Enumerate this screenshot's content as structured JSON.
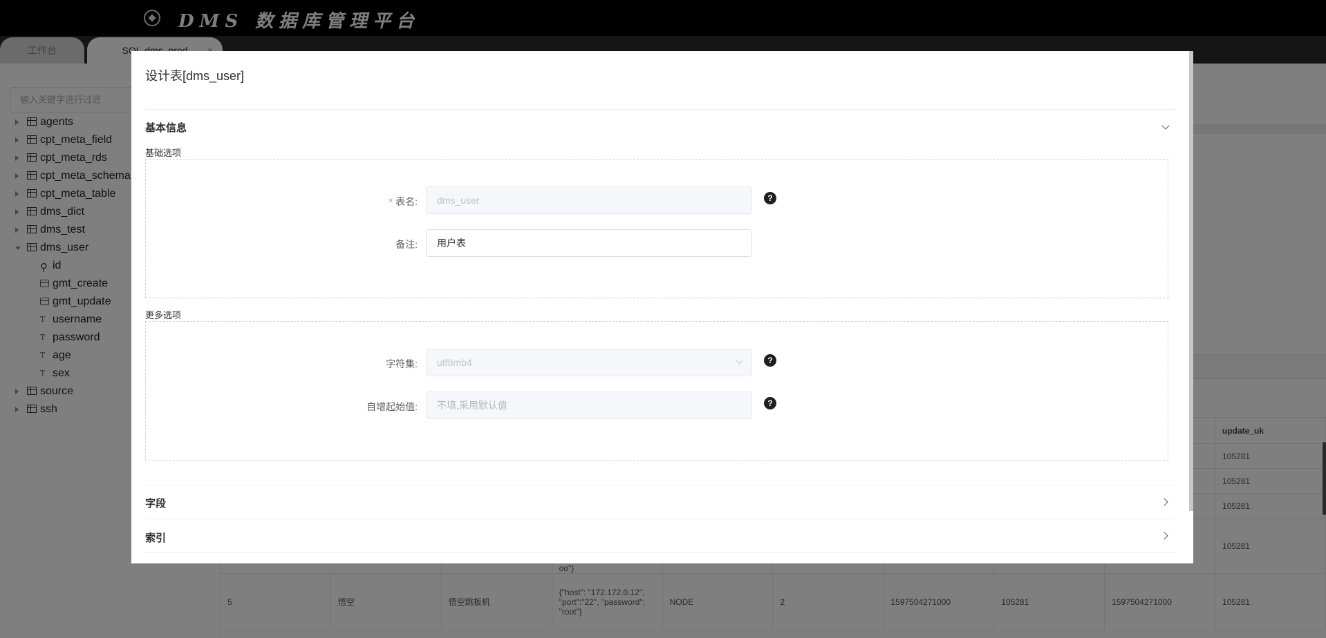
{
  "header": {
    "brand": "DMS 数据库管理平台"
  },
  "tabs": [
    {
      "label": "工作台"
    },
    {
      "label": "SQL-dms_prod",
      "close": "×"
    }
  ],
  "sidebar": {
    "filter_placeholder": "输入关键字进行过滤",
    "tables": [
      {
        "name": "agents"
      },
      {
        "name": "cpt_meta_field"
      },
      {
        "name": "cpt_meta_rds"
      },
      {
        "name": "cpt_meta_schema"
      },
      {
        "name": "cpt_meta_table"
      },
      {
        "name": "dms_dict"
      },
      {
        "name": "dms_test"
      },
      {
        "name": "dms_user",
        "expanded": true
      },
      {
        "name": "source"
      },
      {
        "name": "ssh"
      }
    ],
    "columns": [
      {
        "name": "id",
        "icon": "key-icon"
      },
      {
        "name": "gmt_create",
        "icon": "datetime-icon"
      },
      {
        "name": "gmt_update",
        "icon": "datetime-icon"
      },
      {
        "name": "username",
        "icon": "text-type-icon"
      },
      {
        "name": "password",
        "icon": "text-type-icon"
      },
      {
        "name": "age",
        "icon": "text-type-icon"
      },
      {
        "name": "sex",
        "icon": "text-type-icon"
      }
    ]
  },
  "result_grid": {
    "last_header": "update_uk",
    "rows": [
      {
        "c9": "105281"
      },
      {
        "c9": "105281"
      },
      {
        "c9": "105281"
      },
      {
        "c3_tail": "oo\"}",
        "c9": "105281"
      },
      {
        "c0": "5",
        "c1": "悟空",
        "c2": "悟空跳板机",
        "c3": "{\"host\": \"172.172.0.12\", \"port\":\"22\", \"password\": \"root\"}",
        "c4": "NODE",
        "c5": "2",
        "c6": "1597504271000",
        "c7": "105281",
        "c8": "1597504271000",
        "c9": "105281"
      }
    ]
  },
  "modal": {
    "title": "设计表[dms_user]",
    "basic_section": "基本信息",
    "basic_options": "基础选项",
    "table_name_label": "表名:",
    "table_name_value": "dms_user",
    "remark_label": "备注:",
    "remark_value": "用户表",
    "more_options": "更多选项",
    "charset_label": "字符集:",
    "charset_value": "utf8mb4",
    "auto_inc_label": "自增起始值:",
    "auto_inc_placeholder": "不填,采用默认值",
    "fields_section": "字段",
    "index_section": "索引",
    "help_glyph": "?"
  }
}
